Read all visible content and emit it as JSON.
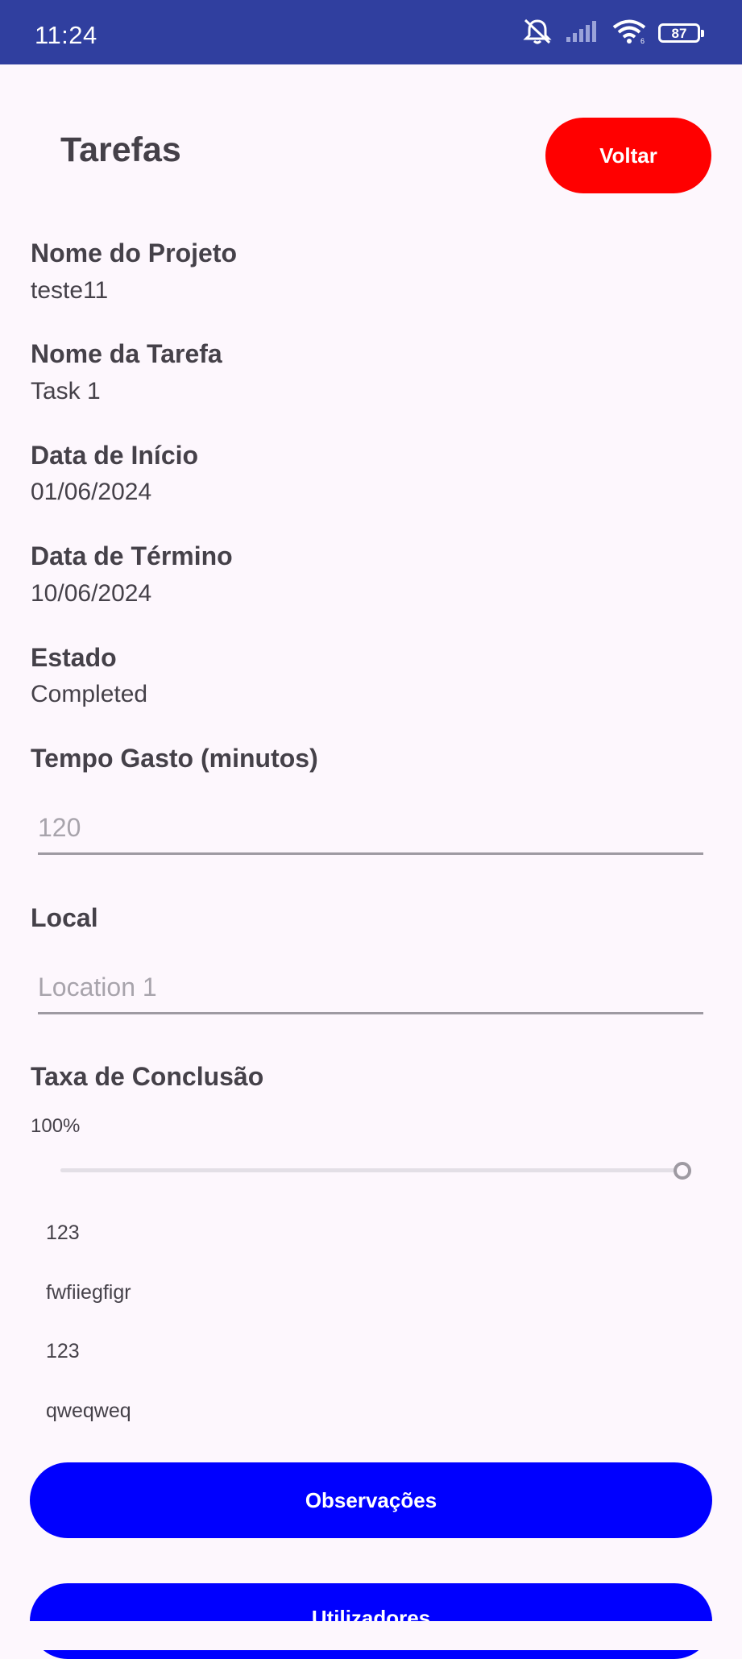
{
  "status_bar": {
    "time": "11:24",
    "battery_level": "87",
    "icons": [
      "mute-notifications-icon",
      "signal-icon",
      "wifi-icon",
      "battery-icon"
    ]
  },
  "header": {
    "title": "Tarefas",
    "back_label": "Voltar",
    "back_color": "#ff0000"
  },
  "fields": {
    "project_name": {
      "label": "Nome do Projeto",
      "value": "teste11"
    },
    "task_name": {
      "label": "Nome da Tarefa",
      "value": "Task 1"
    },
    "start_date": {
      "label": "Data de Início",
      "value": "01/06/2024"
    },
    "end_date": {
      "label": "Data de Término",
      "value": "10/06/2024"
    },
    "status": {
      "label": "Estado",
      "value": "Completed"
    }
  },
  "time_spent": {
    "label": "Tempo Gasto (minutos)",
    "placeholder": "120"
  },
  "location": {
    "label": "Local",
    "placeholder": "Location 1"
  },
  "completion": {
    "label": "Taxa de Conclusão",
    "value_text": "100%",
    "fraction": 1.0
  },
  "observations": [
    "123",
    "fwfiiegfigr",
    "123",
    "qweqweq"
  ],
  "actions": {
    "observations_label": "Observações",
    "users_label": "Utilizadores",
    "primary_color": "#0000ff"
  }
}
